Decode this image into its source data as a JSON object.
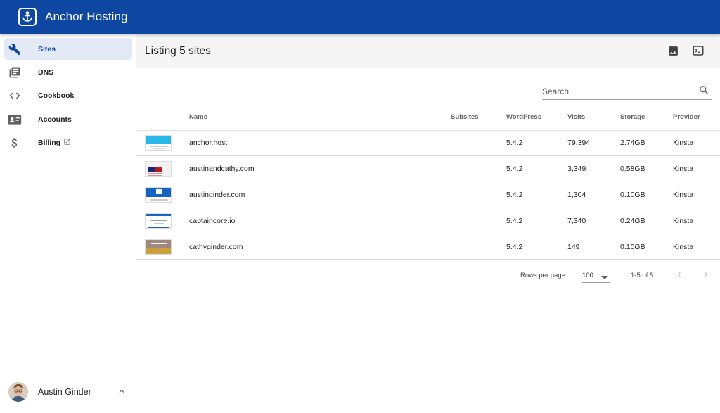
{
  "app": {
    "title": "Anchor Hosting"
  },
  "sidebar": {
    "items": [
      {
        "label": "Sites",
        "icon": "wrench-icon",
        "active": true
      },
      {
        "label": "DNS",
        "icon": "book-icon"
      },
      {
        "label": "Cookbook",
        "icon": "code-icon"
      },
      {
        "label": "Accounts",
        "icon": "account-card-icon"
      },
      {
        "label": "Billing",
        "icon": "dollar-icon",
        "external": true
      }
    ],
    "user": {
      "name": "Austin Ginder"
    }
  },
  "toolbar": {
    "title": "Listing 5 sites"
  },
  "search": {
    "placeholder": "Search",
    "value": ""
  },
  "table": {
    "columns": [
      "Name",
      "Subsites",
      "WordPress",
      "Visits",
      "Storage",
      "Provider"
    ],
    "rows": [
      {
        "name": "anchor.host",
        "subsites": "",
        "wordpress": "5.4.2",
        "visits": "79,394",
        "storage": "2.74GB",
        "provider": "Kinsta"
      },
      {
        "name": "austinandcathy.com",
        "subsites": "",
        "wordpress": "5.4.2",
        "visits": "3,349",
        "storage": "0.58GB",
        "provider": "Kinsta"
      },
      {
        "name": "austinginder.com",
        "subsites": "",
        "wordpress": "5.4.2",
        "visits": "1,304",
        "storage": "0.10GB",
        "provider": "Kinsta"
      },
      {
        "name": "captaincore.io",
        "subsites": "",
        "wordpress": "5.4.2",
        "visits": "7,340",
        "storage": "0.24GB",
        "provider": "Kinsta"
      },
      {
        "name": "cathyginder.com",
        "subsites": "",
        "wordpress": "5.4.2",
        "visits": "149",
        "storage": "0.10GB",
        "provider": "Kinsta"
      }
    ]
  },
  "pagination": {
    "rows_per_page_label": "Rows per page:",
    "rows_per_page": "100",
    "range": "1-5 of 5"
  },
  "colors": {
    "primary": "#0d47a1",
    "active_bg": "#e3eaf6",
    "toolbar_bg": "#f5f5f5"
  }
}
